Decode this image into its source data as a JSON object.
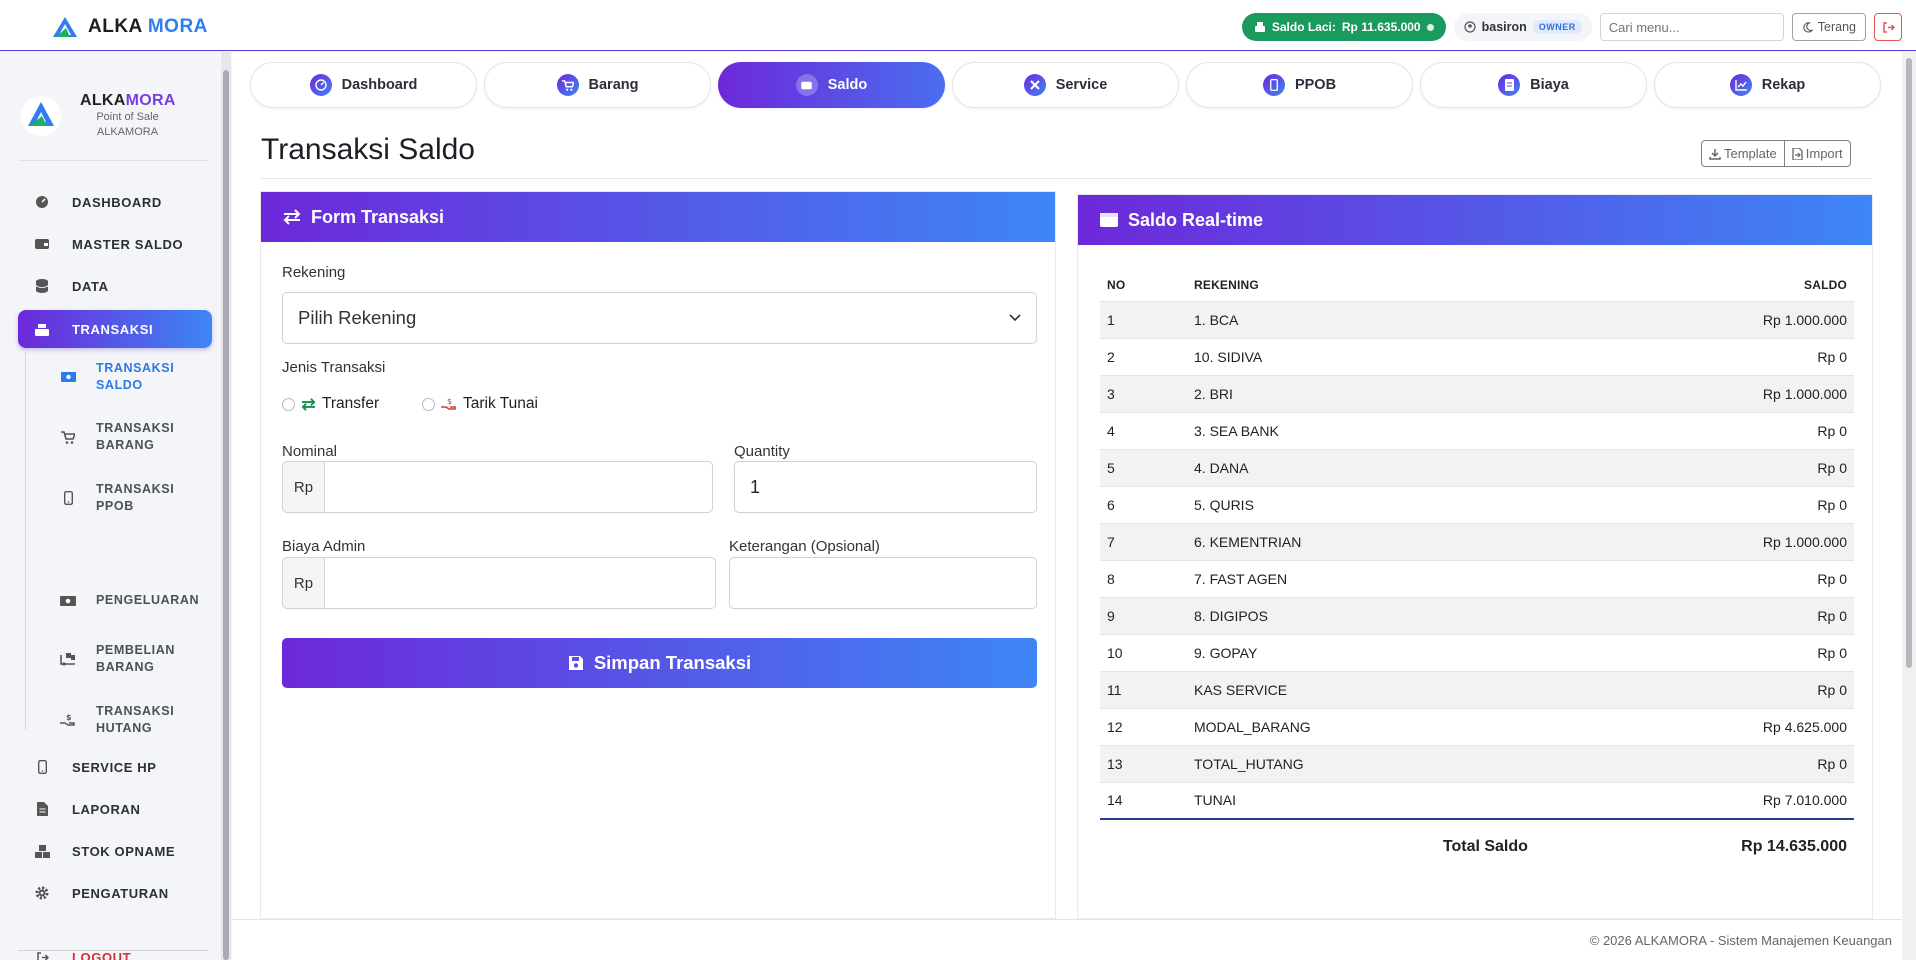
{
  "topbar": {
    "brand_part1": "ALKA",
    "brand_part2": "MORA",
    "saldo_label": "Saldo Laci:",
    "saldo_value": "Rp 11.635.000",
    "username": "basiron",
    "role_badge": "OWNER",
    "search_placeholder": "Cari menu...",
    "theme_label": "Terang"
  },
  "sidebar": {
    "brand_part1": "ALKA",
    "brand_part2": "MORA",
    "subtitle1": "Point of Sale",
    "subtitle2": "ALKAMORA",
    "items": [
      {
        "label": "DASHBOARD"
      },
      {
        "label": "MASTER SALDO"
      },
      {
        "label": "DATA"
      },
      {
        "label": "TRANSAKSI"
      },
      {
        "label": "SERVICE HP"
      },
      {
        "label": "LAPORAN"
      },
      {
        "label": "STOK OPNAME"
      },
      {
        "label": "PENGATURAN"
      },
      {
        "label": "LOGOUT"
      }
    ],
    "sub_items": [
      {
        "label": "TRANSAKSI SALDO"
      },
      {
        "label": "TRANSAKSI BARANG"
      },
      {
        "label": "TRANSAKSI PPOB"
      },
      {
        "label": "PENGELUARAN"
      },
      {
        "label": "PEMBELIAN BARANG"
      },
      {
        "label": "TRANSAKSI HUTANG"
      }
    ]
  },
  "tabs": [
    {
      "label": "Dashboard"
    },
    {
      "label": "Barang"
    },
    {
      "label": "Saldo"
    },
    {
      "label": "Service"
    },
    {
      "label": "PPOB"
    },
    {
      "label": "Biaya"
    },
    {
      "label": "Rekap"
    }
  ],
  "page": {
    "title": "Transaksi Saldo",
    "template_label": "Template",
    "import_label": "Import"
  },
  "form": {
    "header": "Form Transaksi",
    "rekening_label": "Rekening",
    "rekening_value": "Pilih Rekening",
    "jenis_label": "Jenis Transaksi",
    "radio_transfer": "Transfer",
    "radio_tarik": "Tarik Tunai",
    "nominal_label": "Nominal",
    "nominal_prefix": "Rp",
    "quantity_label": "Quantity",
    "quantity_value": "1",
    "admin_label": "Biaya Admin",
    "admin_prefix": "Rp",
    "keterangan_label": "Keterangan (Opsional)",
    "submit_label": "Simpan Transaksi"
  },
  "saldo": {
    "header": "Saldo Real-time",
    "columns": [
      "NO",
      "REKENING",
      "SALDO"
    ],
    "rows": [
      [
        "1",
        "1. BCA",
        "Rp 1.000.000"
      ],
      [
        "2",
        "10. SIDIVA",
        "Rp 0"
      ],
      [
        "3",
        "2. BRI",
        "Rp 1.000.000"
      ],
      [
        "4",
        "3. SEA BANK",
        "Rp 0"
      ],
      [
        "5",
        "4. DANA",
        "Rp 0"
      ],
      [
        "6",
        "5. QURIS",
        "Rp 0"
      ],
      [
        "7",
        "6. KEMENTRIAN",
        "Rp 1.000.000"
      ],
      [
        "8",
        "7. FAST AGEN",
        "Rp 0"
      ],
      [
        "9",
        "8. DIGIPOS",
        "Rp 0"
      ],
      [
        "10",
        "9. GOPAY",
        "Rp 0"
      ],
      [
        "11",
        "KAS SERVICE",
        "Rp 0"
      ],
      [
        "12",
        "MODAL_BARANG",
        "Rp 4.625.000"
      ],
      [
        "13",
        "TOTAL_HUTANG",
        "Rp 0"
      ],
      [
        "14",
        "TUNAI",
        "Rp 7.010.000"
      ]
    ],
    "total_label": "Total Saldo",
    "total_value": "Rp 14.635.000"
  },
  "footer": {
    "text": "© 2026 ALKAMORA - Sistem Manajemen Keuangan"
  },
  "colors": {
    "gradient_start": "#6d28d9",
    "gradient_end": "#3d86f5",
    "saldo_pill": "#1b9a5e",
    "logout": "#d6303a"
  }
}
